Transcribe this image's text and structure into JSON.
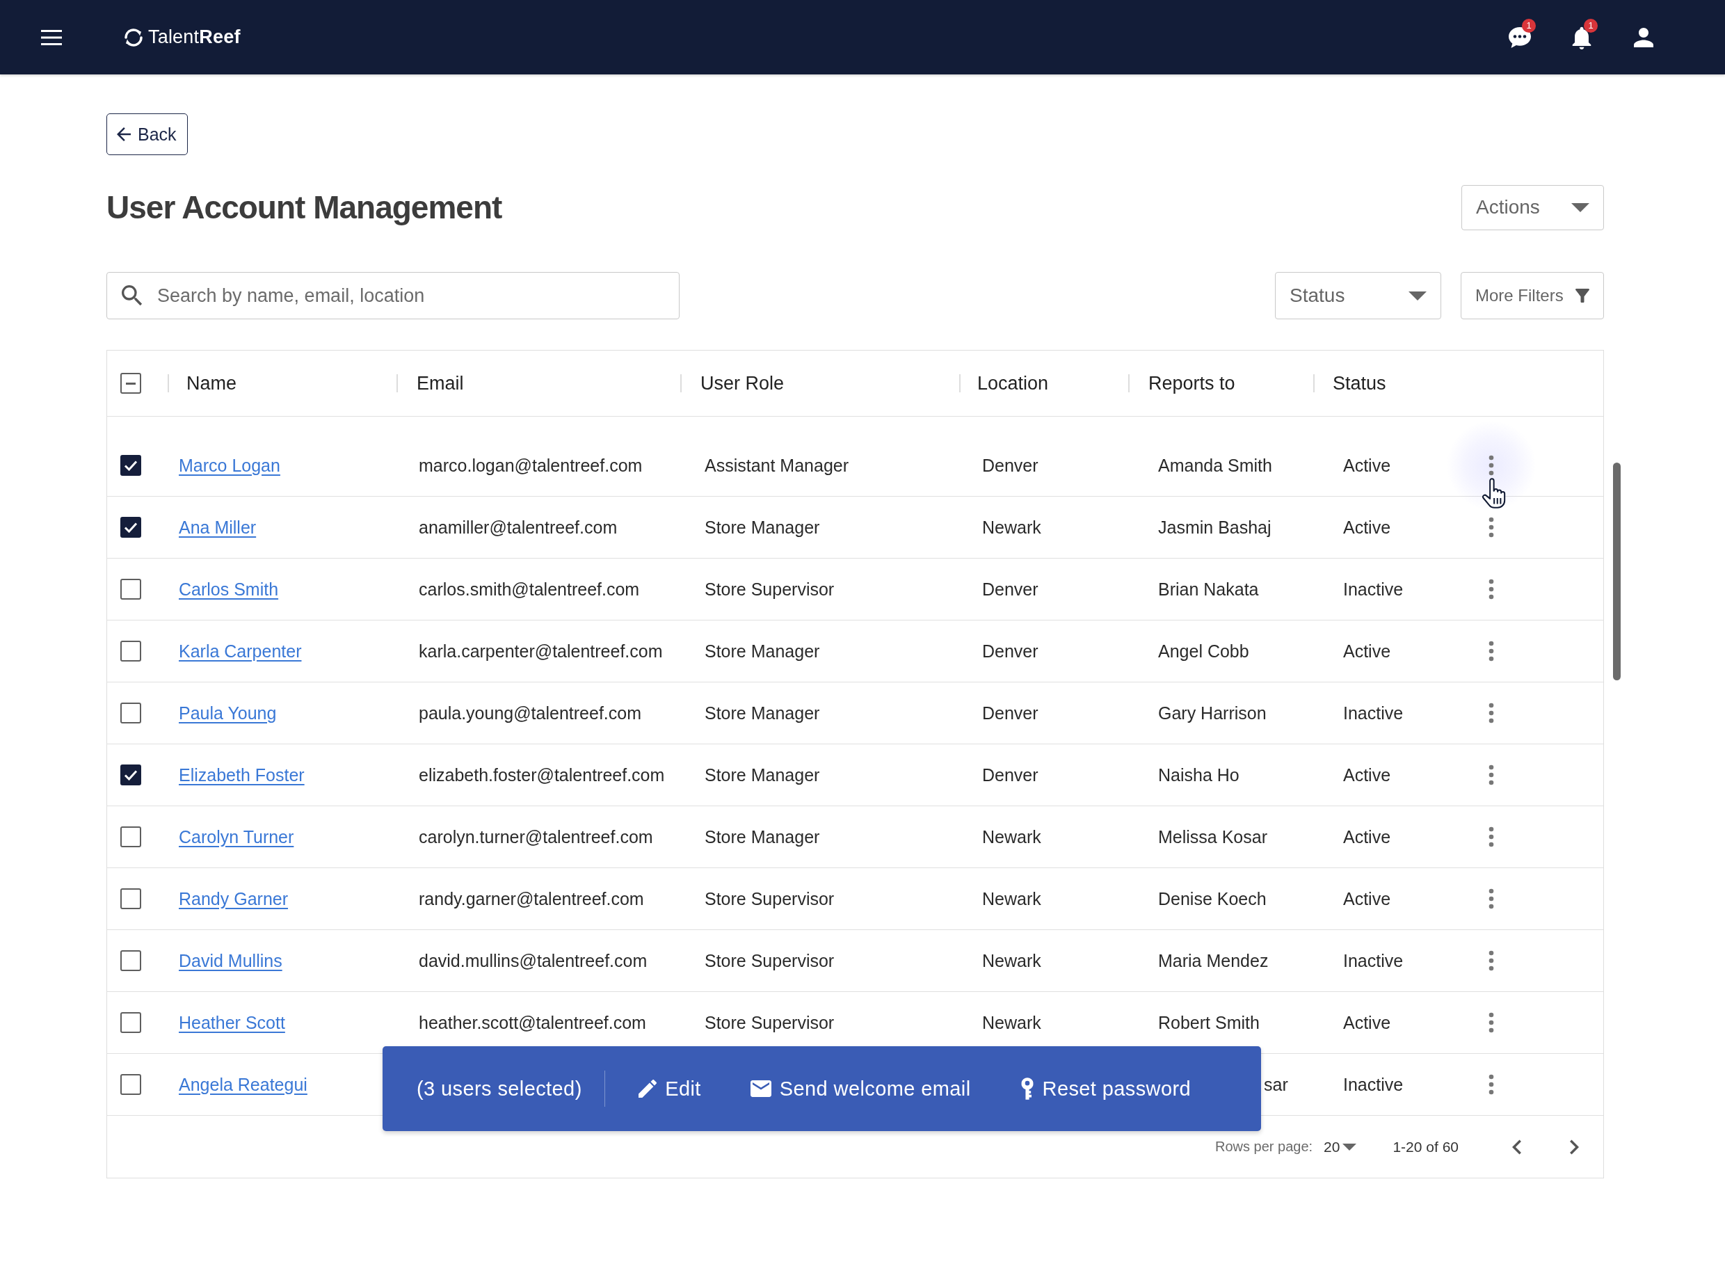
{
  "top_bar": {
    "logo": "Talent**Reef**",
    "icons": [
      {
        "kind": "messages",
        "badge": "1"
      },
      {
        "kind": "notifications",
        "badge": "1"
      },
      {
        "kind": "account"
      }
    ]
  },
  "back_button": {
    "label": "Back"
  },
  "title": "User Account Management",
  "actions_button": {
    "label": "Actions"
  },
  "search": {
    "placeholder": "Search by name, email, location"
  },
  "status_filter": {
    "label": "Status"
  },
  "more_filters_button": {
    "label": "More Filters"
  },
  "table": {
    "select_all": {
      "indeterminate": true
    },
    "columns": [
      "Name",
      "Email",
      "User Role",
      "Location",
      "Reports to",
      "Status"
    ],
    "rows": [
      {
        "checked": true,
        "name": "Marco Logan",
        "email": "marco.logan@talentreef.com",
        "role": "Assistant Manager",
        "location": "Denver",
        "reports_to": "Amanda Smith",
        "status": "Active",
        "menu_hovered": true,
        "covered": false
      },
      {
        "checked": true,
        "name": "Ana Miller",
        "email": "anamiller@talentreef.com",
        "role": "Store Manager",
        "location": "Newark",
        "reports_to": "Jasmin Bashaj",
        "status": "Active",
        "menu_hovered": false,
        "covered": false
      },
      {
        "checked": false,
        "name": "Carlos Smith",
        "email": "carlos.smith@talentreef.com",
        "role": "Store Supervisor",
        "location": "Denver",
        "reports_to": "Brian Nakata",
        "status": "Inactive",
        "menu_hovered": false,
        "covered": false
      },
      {
        "checked": false,
        "name": "Karla Carpenter",
        "email": "karla.carpenter@talentreef.com",
        "role": "Store Manager",
        "location": "Denver",
        "reports_to": "Angel Cobb",
        "status": "Active",
        "menu_hovered": false,
        "covered": false
      },
      {
        "checked": false,
        "name": "Paula Young",
        "email": "paula.young@talentreef.com",
        "role": "Store Manager",
        "location": "Denver",
        "reports_to": "Gary Harrison",
        "status": "Inactive",
        "menu_hovered": false,
        "covered": false
      },
      {
        "checked": true,
        "name": "Elizabeth Foster",
        "email": "elizabeth.foster@talentreef.com",
        "role": "Store Manager",
        "location": "Denver",
        "reports_to": "Naisha Ho",
        "status": "Active",
        "menu_hovered": false,
        "covered": false
      },
      {
        "checked": false,
        "name": "Carolyn Turner",
        "email": "carolyn.turner@talentreef.com",
        "role": "Store Manager",
        "location": "Newark",
        "reports_to": "Melissa Kosar",
        "status": "Active",
        "menu_hovered": false,
        "covered": false
      },
      {
        "checked": false,
        "name": "Randy Garner",
        "email": "randy.garner@talentreef.com",
        "role": "Store Supervisor",
        "location": "Newark",
        "reports_to": "Denise Koech",
        "status": "Active",
        "menu_hovered": false,
        "covered": false
      },
      {
        "checked": false,
        "name": "David Mullins",
        "email": "david.mullins@talentreef.com",
        "role": "Store Supervisor",
        "location": "Newark",
        "reports_to": "Maria Mendez",
        "status": "Inactive",
        "menu_hovered": false,
        "covered": false
      },
      {
        "checked": false,
        "name": "Heather Scott",
        "email": "heather.scott@talentreef.com",
        "role": "Store Supervisor",
        "location": "Newark",
        "reports_to": "Robert Smith",
        "status": "Active",
        "menu_hovered": false,
        "covered": false
      },
      {
        "checked": false,
        "name": "Angela Reategui",
        "reports_to": "sar",
        "status": "Inactive",
        "menu_hovered": false,
        "covered": true
      }
    ]
  },
  "selection_bar": {
    "count_label": "(3 users selected)",
    "actions": [
      {
        "kind": "edit",
        "label": "Edit"
      },
      {
        "kind": "email",
        "label": "Send welcome email"
      },
      {
        "kind": "password",
        "label": "Reset password"
      }
    ]
  },
  "pagination": {
    "rows_per_page_label": "Rows per page:",
    "rows_per_page": "20",
    "range": "1-20 of 60"
  }
}
